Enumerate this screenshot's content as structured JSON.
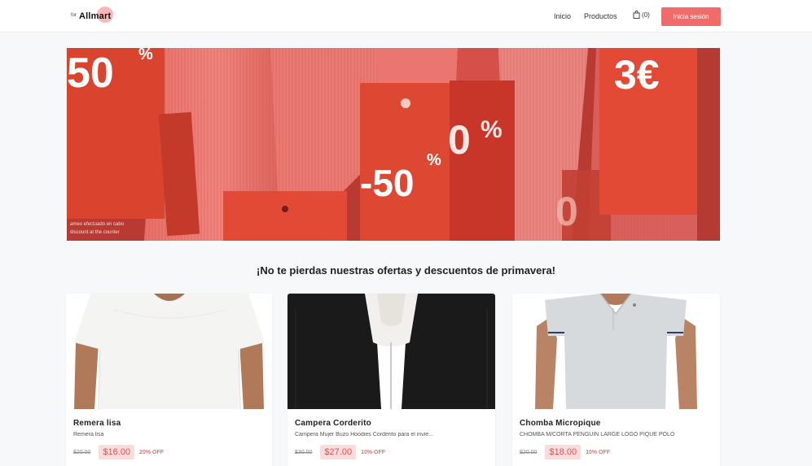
{
  "header": {
    "logo_prefix": "for",
    "logo_text": "Allmart",
    "nav_home": "Inicio",
    "nav_products": "Productos",
    "cart_count": "(0)",
    "login_label": "Inicia sesión"
  },
  "hero": {
    "tag_left": "50",
    "tag_left_pct": "%",
    "tag_center": "-50",
    "tag_center_pct": "%",
    "tag_right": "3€",
    "tag_mid_right": "0",
    "tag_mid_right_pct": "%",
    "small_print_1": "ameo efectuado en cabo",
    "small_print_2": "discount at the counter"
  },
  "promo": {
    "title": "¡No te pierdas nuestras ofertas y descuentos de primavera!"
  },
  "products": [
    {
      "title": "Remera lisa",
      "description": "Remera lisa",
      "old_price": "$20.00",
      "price": "$16.00",
      "discount": "20% OFF"
    },
    {
      "title": "Campera Corderito",
      "description": "Campera Mujer Buzo Hoodies Corderito para el invie...",
      "old_price": "$30.00",
      "price": "$27.00",
      "discount": "10% OFF"
    },
    {
      "title": "Chomba Micropique",
      "description": "CHOMBA M/CORTA PENGUIN LARGE LOGO PIQUE POLO",
      "old_price": "$20.00",
      "price": "$18.00",
      "discount": "10% OFF"
    }
  ],
  "colors": {
    "accent": "#f26b6b",
    "price_bg": "#fbdcdc"
  }
}
